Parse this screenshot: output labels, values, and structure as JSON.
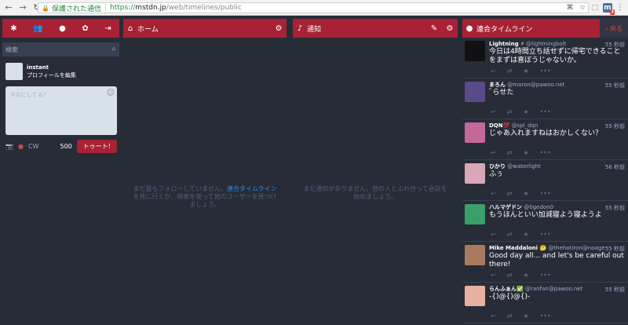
{
  "browser": {
    "secure_label": "保護された通信",
    "url_proto": "https://",
    "url_host": "mstdn.jp",
    "url_path": "/web/timelines/public",
    "ext_badge": "3"
  },
  "compose": {
    "search_placeholder": "検索",
    "username": "instant",
    "edit_profile": "プロフィールを編集",
    "textarea_placeholder": "今なにしてる？",
    "cw_label": "CW",
    "char_count": "500",
    "toot_label": "トゥート!"
  },
  "home": {
    "title": "ホーム",
    "empty_pre": "まだ誰もフォローしていません。",
    "empty_link": "連合タイムライン",
    "empty_post": "を見に行くか、検索を使って他のユーザーを見つけましょう。"
  },
  "notifications": {
    "title": "通知",
    "empty": "まだ通知がありません。他の人とふれ合って会話を始めましょう。"
  },
  "public": {
    "title": "連合タイムライン",
    "back_label": "戻る",
    "statuses": [
      {
        "name": "Lightning ⚡",
        "acct": "@lightningbolt",
        "time": "55 秒前",
        "content": "今日は4時間立ち話せずに帰宅できることをまずは喜ぼうじゃないか。",
        "avatar_color": "#111111"
      },
      {
        "name": "まろん",
        "acct": "@maron@pawoo.net",
        "time": "55 秒前",
        "content": "ﾞらせた",
        "avatar_color": "#5a4a8a"
      },
      {
        "name": "DQN💯",
        "acct": "@spl_dqn",
        "time": "55 秒前",
        "content": "じゃあ入れますねはおかしくない？",
        "avatar_color": "#c4689a"
      },
      {
        "name": "ひかり",
        "acct": "@waterlight",
        "time": "56 秒前",
        "content": "ふぅ",
        "avatar_color": "#d9a8b8"
      },
      {
        "name": "ハルマゲドン",
        "acct": "@0gedon0",
        "time": "55 秒前",
        "content": "もうほんといい加減寝よう寝ようよ",
        "avatar_color": "#3aa06a"
      },
      {
        "name": "Mike Maddaloni 🤔",
        "acct": "@thehotiron@noage",
        "time": "55 秒前",
        "content": "Good day all... and let's be careful out there!",
        "avatar_color": "#a87a60"
      },
      {
        "name": "らんふぁん✅",
        "acct": "@ranfan@pawoo.net",
        "time": "55 秒前",
        "content": "-{)@{)@{)-",
        "avatar_color": "#e8b0a0"
      }
    ]
  }
}
